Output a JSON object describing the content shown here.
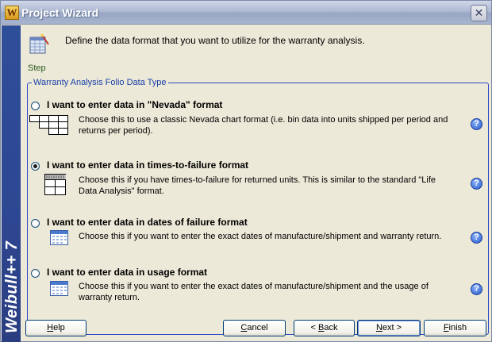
{
  "window": {
    "title": "Project Wizard",
    "app_icon_letter": "W",
    "close_glyph": "✕"
  },
  "sidebar": {
    "brand": "Weibull++ 7"
  },
  "header": {
    "step_label": "Step",
    "description": "Define the data format that you want to utilize for the warranty analysis."
  },
  "group": {
    "label": "Warranty Analysis Folio Data Type",
    "options": [
      {
        "title": "I want to enter data in \"Nevada\" format",
        "description": "Choose this to use a classic Nevada chart format (i.e. bin data into units shipped per period and returns per period).",
        "selected": false,
        "icon": "nevada-grid-icon"
      },
      {
        "title": "I want to enter data in times-to-failure format",
        "description": "Choose this if you have times-to-failure for returned units. This is similar to the standard \"Life Data Analysis\" format.",
        "selected": true,
        "icon": "table-grid-icon"
      },
      {
        "title": "I want to enter data in dates of failure format",
        "description": "Choose this if you want to enter the exact dates of manufacture/shipment and warranty return.",
        "selected": false,
        "icon": "calendar-icon"
      },
      {
        "title": "I want to enter data in usage format",
        "description": "Choose this if you want to enter the exact dates of manufacture/shipment and the usage of warranty return.",
        "selected": false,
        "icon": "calendar-icon"
      }
    ],
    "help_glyph": "?"
  },
  "buttons": {
    "help": {
      "pre": "",
      "key": "H",
      "post": "elp"
    },
    "cancel": {
      "pre": "",
      "key": "C",
      "post": "ancel"
    },
    "back": {
      "pre": "< ",
      "key": "B",
      "post": "ack"
    },
    "next": {
      "pre": "",
      "key": "N",
      "post": "ext >"
    },
    "finish": {
      "pre": "",
      "key": "F",
      "post": "inish"
    }
  },
  "colors": {
    "sidebar": "#2e4792",
    "group_border": "#2c47c8",
    "group_label": "#1a3fa8",
    "step_label": "#2a5a1a"
  }
}
